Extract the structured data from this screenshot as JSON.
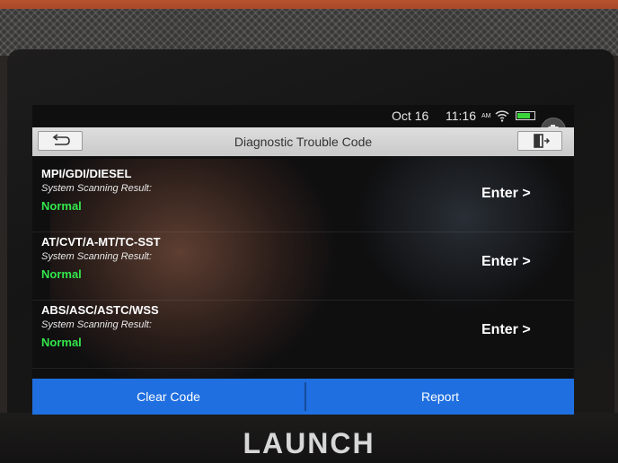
{
  "status_bar": {
    "date": "Oct 16",
    "time": "11:16",
    "ampm": "AM",
    "battery_level": 0.8,
    "battery_color": "#3bd43b"
  },
  "header": {
    "title": "Diagnostic Trouble Code",
    "back_icon": "back-arrow-icon",
    "exit_icon": "exit-door-icon"
  },
  "systems": [
    {
      "name": "MPI/GDI/DIESEL",
      "scan_label": "System Scanning Result:",
      "status": "Normal",
      "action": "Enter >"
    },
    {
      "name": "AT/CVT/A-MT/TC-SST",
      "scan_label": "System Scanning Result:",
      "status": "Normal",
      "action": "Enter >"
    },
    {
      "name": "ABS/ASC/ASTC/WSS",
      "scan_label": "System Scanning Result:",
      "status": "Normal",
      "action": "Enter >"
    }
  ],
  "footer": {
    "clear_code_label": "Clear Code",
    "report_label": "Report",
    "accent_color": "#1f6fe0"
  },
  "device": {
    "brand": "LAUNCH"
  },
  "colors": {
    "status_normal": "#33e64c"
  }
}
